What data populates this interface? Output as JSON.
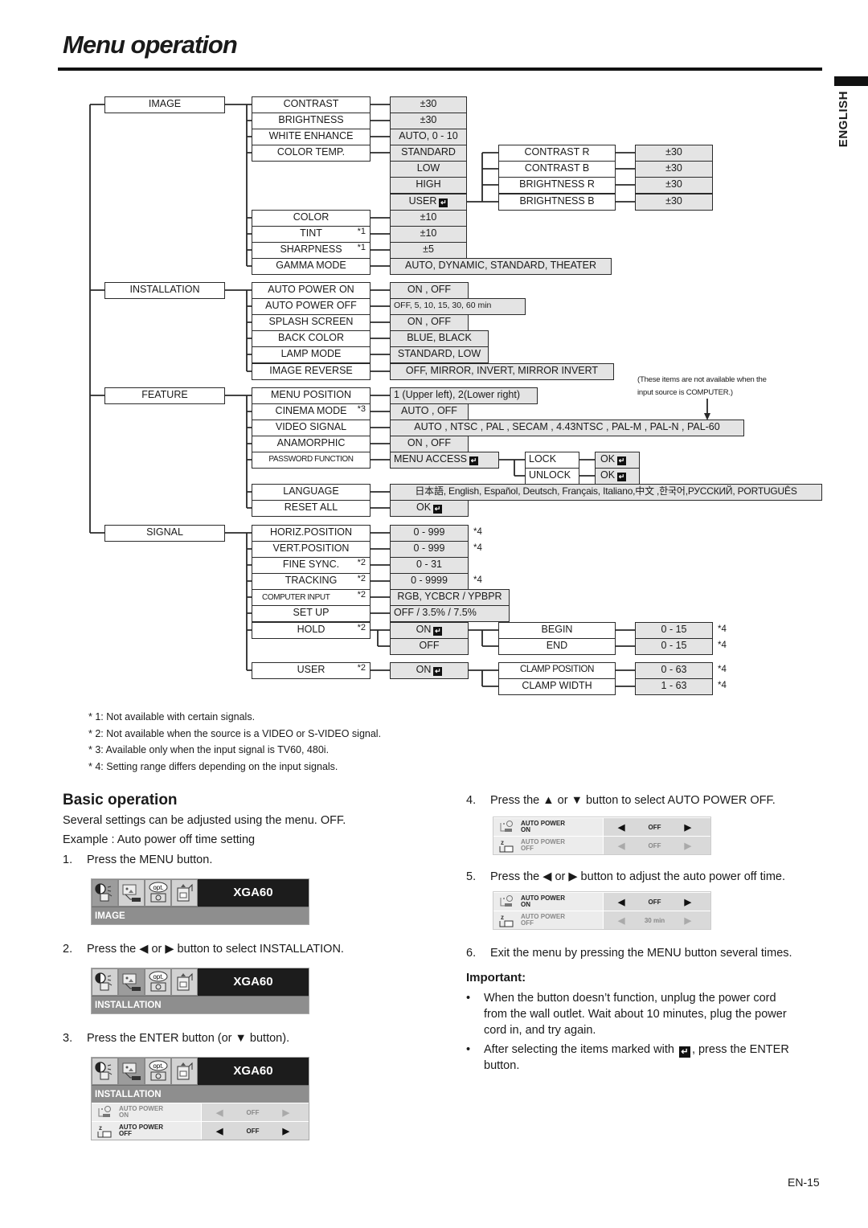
{
  "page": {
    "title": "Menu operation",
    "language_tab": "ENGLISH",
    "page_number": "EN-15"
  },
  "tree": {
    "image": {
      "label": "IMAGE",
      "contrast": {
        "label": "CONTRAST",
        "value": "±30"
      },
      "brightness": {
        "label": "BRIGHTNESS",
        "value": "±30"
      },
      "white_enhance": {
        "label": "WHITE ENHANCE",
        "value": "AUTO, 0 - 10"
      },
      "color_temp": {
        "label": "COLOR TEMP.",
        "options": [
          "STANDARD",
          "LOW",
          "HIGH",
          "USER"
        ],
        "user_sub": [
          {
            "label": "CONTRAST R",
            "value": "±30"
          },
          {
            "label": "CONTRAST B",
            "value": "±30"
          },
          {
            "label": "BRIGHTNESS R",
            "value": "±30"
          },
          {
            "label": "BRIGHTNESS B",
            "value": "±30"
          }
        ]
      },
      "color": {
        "label": "COLOR",
        "value": "±10"
      },
      "tint": {
        "label": "TINT",
        "note": "*1",
        "value": "±10"
      },
      "sharpness": {
        "label": "SHARPNESS",
        "note": "*1",
        "value": "±5"
      },
      "gamma_mode": {
        "label": "GAMMA MODE",
        "value": "AUTO, DYNAMIC, STANDARD, THEATER"
      }
    },
    "installation": {
      "label": "INSTALLATION",
      "auto_power_on": {
        "label": "AUTO POWER ON",
        "value": "ON , OFF"
      },
      "auto_power_off": {
        "label": "AUTO POWER OFF",
        "value": "OFF, 5, 10, 15, 30, 60 min"
      },
      "splash_screen": {
        "label": "SPLASH SCREEN",
        "value": "ON , OFF"
      },
      "back_color": {
        "label": "BACK COLOR",
        "value": "BLUE, BLACK"
      },
      "lamp_mode": {
        "label": "LAMP MODE",
        "value": "STANDARD, LOW"
      },
      "image_reverse": {
        "label": "IMAGE REVERSE",
        "value": "OFF, MIRROR, INVERT, MIRROR INVERT"
      }
    },
    "feature": {
      "label": "FEATURE",
      "menu_position": {
        "label": "MENU POSITION",
        "value": "1 (Upper left), 2(Lower right)"
      },
      "cinema_mode": {
        "label": "CINEMA MODE",
        "note": "*3",
        "value": "AUTO , OFF"
      },
      "video_signal": {
        "label": "VIDEO SIGNAL",
        "value": "AUTO , NTSC , PAL , SECAM , 4.43NTSC , PAL-M , PAL-N , PAL-60"
      },
      "anamorphic": {
        "label": "ANAMORPHIC",
        "value": "ON , OFF"
      },
      "password_function": {
        "label": "PASSWORD FUNCTION",
        "value": "MENU ACCESS",
        "sub": [
          {
            "label": "LOCK",
            "value": "OK"
          },
          {
            "label": "UNLOCK",
            "value": "OK"
          }
        ]
      },
      "language": {
        "label": "LANGUAGE",
        "value": "日本語, English, Español, Deutsch, Français, Italiano,中文 ,한국어,РУССКИЙ, PORTUGUÊS"
      },
      "reset_all": {
        "label": "RESET ALL",
        "value": "OK"
      },
      "computer_note": [
        "(These items are not available when the",
        "input source is COMPUTER.)"
      ]
    },
    "signal": {
      "label": "SIGNAL",
      "horiz_position": {
        "label": "HORIZ.POSITION",
        "value": "0 - 999",
        "ext_note": "*4"
      },
      "vert_position": {
        "label": "VERT.POSITION",
        "value": "0 - 999",
        "ext_note": "*4"
      },
      "fine_sync": {
        "label": "FINE SYNC.",
        "note": "*2",
        "value": "0 - 31"
      },
      "tracking": {
        "label": "TRACKING",
        "note": "*2",
        "value": "0 - 9999",
        "ext_note": "*4"
      },
      "computer_input": {
        "label": "COMPUTER INPUT",
        "note": "*2",
        "value": "RGB, YCBCR / YPBPR"
      },
      "set_up": {
        "label": "SET UP",
        "value": "OFF / 3.5% / 7.5%"
      },
      "hold": {
        "label": "HOLD",
        "note": "*2",
        "options": [
          "ON",
          "OFF"
        ],
        "sub": [
          {
            "label": "BEGIN",
            "value": "0 - 15",
            "ext_note": "*4"
          },
          {
            "label": "END",
            "value": "0 - 15",
            "ext_note": "*4"
          }
        ]
      },
      "user": {
        "label": "USER",
        "note": "*2",
        "value": "ON",
        "sub": [
          {
            "label": "CLAMP POSITION",
            "value": "0 - 63",
            "ext_note": "*4"
          },
          {
            "label": "CLAMP WIDTH",
            "value": "1 - 63",
            "ext_note": "*4"
          }
        ]
      }
    }
  },
  "footnotes": [
    "* 1: Not available with certain signals.",
    "* 2: Not available when the source is a VIDEO or S-VIDEO signal.",
    "* 3: Available only when the input signal is TV60, 480i.",
    "* 4: Setting range differs depending on the input signals."
  ],
  "basic": {
    "heading": "Basic operation",
    "intro": "Several settings can be adjusted using the menu. OFF.",
    "example": "Example : Auto power off time setting",
    "steps": [
      {
        "num": "1.",
        "text": "Press the MENU button."
      },
      {
        "num": "2.",
        "text": "Press the ◀ or ▶ button to select INSTALLATION."
      },
      {
        "num": "3.",
        "text": "Press the ENTER button (or ▼ button)."
      },
      {
        "num": "4.",
        "text": "Press the ▲ or ▼ button to select AUTO POWER OFF."
      },
      {
        "num": "5.",
        "text": "Press the ◀ or ▶ button to adjust the auto power off time."
      },
      {
        "num": "6.",
        "text": "Exit the menu by pressing the MENU button several times."
      }
    ],
    "important": {
      "heading": "Important:",
      "bullet1": [
        "When the button doesn’t function, unplug the power cord",
        "from the wall outlet. Wait about 10 minutes, plug the power",
        "cord in, and try again."
      ],
      "bullet2_before": "After selecting the items marked with",
      "bullet2_after": ", press the ENTER",
      "bullet2_line2": "button."
    }
  },
  "osd": {
    "model": "XGA60",
    "opt_label": "opt.",
    "screen1_bar": "IMAGE",
    "screen2_bar": "INSTALLATION",
    "screen3_bar": "INSTALLATION",
    "row_title": "AUTO POWER",
    "row_on": "ON",
    "row_off": "OFF",
    "screen3_values": [
      "OFF",
      "OFF"
    ],
    "step4_values": [
      "OFF",
      "OFF"
    ],
    "step5_values": [
      "OFF",
      "30 min"
    ]
  }
}
